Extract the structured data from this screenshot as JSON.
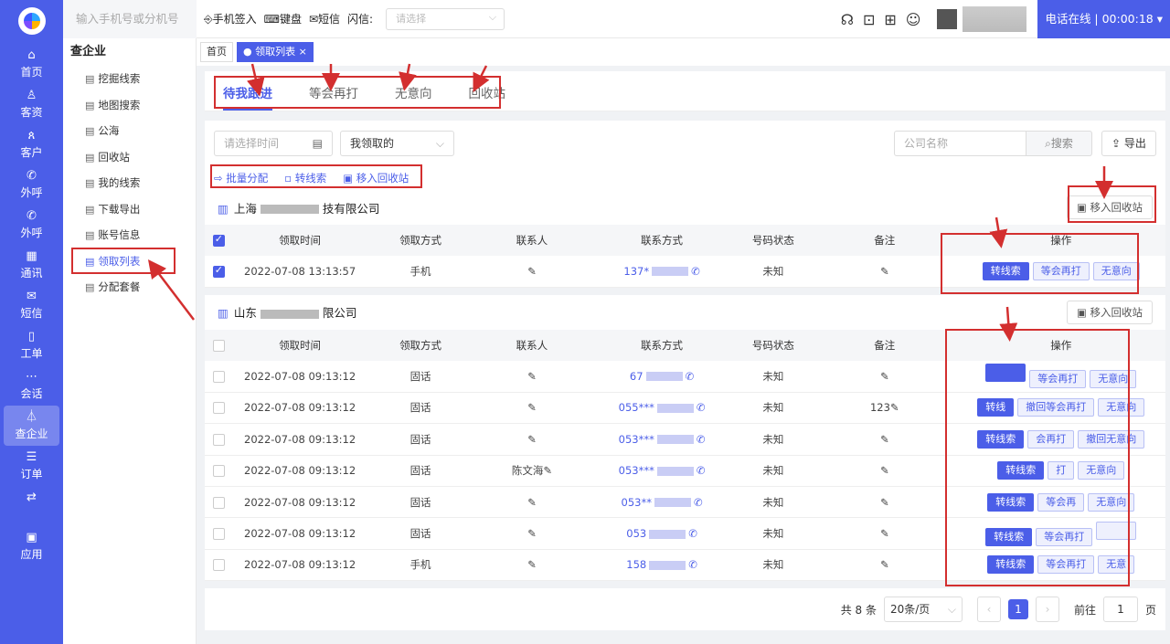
{
  "nav": {
    "items": [
      {
        "icon": "⌂",
        "label": "首页"
      },
      {
        "icon": "♙",
        "label": "客资"
      },
      {
        "icon": "ጰ",
        "label": "客户"
      },
      {
        "icon": "✆",
        "label": "外呼"
      },
      {
        "icon": "✆",
        "label": "外呼"
      },
      {
        "icon": "▦",
        "label": "通讯"
      },
      {
        "icon": "✉",
        "label": "短信"
      },
      {
        "icon": "▯",
        "label": "工单"
      },
      {
        "icon": "⋯",
        "label": "会话"
      },
      {
        "icon": "⏃",
        "label": "查企业"
      },
      {
        "icon": "☰",
        "label": "订单"
      },
      {
        "icon": "⇄",
        "label": ""
      },
      {
        "icon": "▣",
        "label": "应用"
      }
    ]
  },
  "subnav": {
    "group": "查企业",
    "items": [
      "挖掘线索",
      "地图搜索",
      "公海",
      "回收站",
      "我的线索",
      "下载导出",
      "账号信息",
      "领取列表",
      "分配套餐"
    ]
  },
  "topbar": {
    "phone_placeholder": "输入手机号或分机号",
    "checkin": "手机签入",
    "keyboard": "键盘",
    "sms": "短信",
    "flash_label": "闪信:",
    "flash_placeholder": "请选择",
    "status": "电话在线 |",
    "timer": "00:00:18"
  },
  "pagetabs": {
    "home": "首页",
    "current": "领取列表"
  },
  "subtabs": [
    "待我跟进",
    "等会再打",
    "无意向",
    "回收站"
  ],
  "filters": {
    "time_placeholder": "请选择时间",
    "mine": "我领取的",
    "company_placeholder": "公司名称",
    "search": "搜索",
    "export": "导出"
  },
  "bulk": {
    "assign": "批量分配",
    "convert": "转线索",
    "recycle": "移入回收站"
  },
  "headers": [
    "领取时间",
    "领取方式",
    "联系人",
    "联系方式",
    "号码状态",
    "备注",
    "操作"
  ],
  "companies": [
    {
      "name": "上海",
      "suffix": "技有限公司",
      "move": "移入回收站",
      "rows": [
        {
          "time": "2022-07-08 13:13:57",
          "mode": "手机",
          "contact": "",
          "phone": "137*",
          "status": "未知",
          "note": "",
          "ops": [
            "转线索",
            "等会再打",
            "无意向"
          ]
        }
      ]
    },
    {
      "name": "山东",
      "suffix": "限公司",
      "move": "移入回收站",
      "rows": [
        {
          "time": "2022-07-08 09:13:12",
          "mode": "固话",
          "contact": "",
          "phone": "67",
          "status": "未知",
          "note": "",
          "ops": [
            "",
            "等会再打",
            "无意向"
          ]
        },
        {
          "time": "2022-07-08 09:13:12",
          "mode": "固话",
          "contact": "",
          "phone": "055***",
          "status": "未知",
          "note": "123",
          "ops": [
            "转线",
            "撤回等会再打",
            "无意向"
          ]
        },
        {
          "time": "2022-07-08 09:13:12",
          "mode": "固话",
          "contact": "",
          "phone": "053***",
          "status": "未知",
          "note": "",
          "ops": [
            "转线索",
            "会再打",
            "撤回无意向"
          ]
        },
        {
          "time": "2022-07-08 09:13:12",
          "mode": "固话",
          "contact": "陈文海",
          "phone": "053***",
          "status": "未知",
          "note": "",
          "ops": [
            "转线索",
            "打",
            "无意向"
          ]
        },
        {
          "time": "2022-07-08 09:13:12",
          "mode": "固话",
          "contact": "",
          "phone": "053**",
          "status": "未知",
          "note": "",
          "ops": [
            "转线索",
            "等会再",
            "无意向"
          ]
        },
        {
          "time": "2022-07-08 09:13:12",
          "mode": "固话",
          "contact": "",
          "phone": "053",
          "status": "未知",
          "note": "",
          "ops": [
            "转线索",
            "等会再打",
            ""
          ]
        },
        {
          "time": "2022-07-08 09:13:12",
          "mode": "手机",
          "contact": "",
          "phone": "158",
          "status": "未知",
          "note": "",
          "ops": [
            "转线索",
            "等会再打",
            "无意"
          ]
        }
      ]
    }
  ],
  "pager": {
    "total": "共 8 条",
    "size": "20条/页",
    "page": "1",
    "goto": "前往",
    "goto_value": "1",
    "unit": "页"
  }
}
